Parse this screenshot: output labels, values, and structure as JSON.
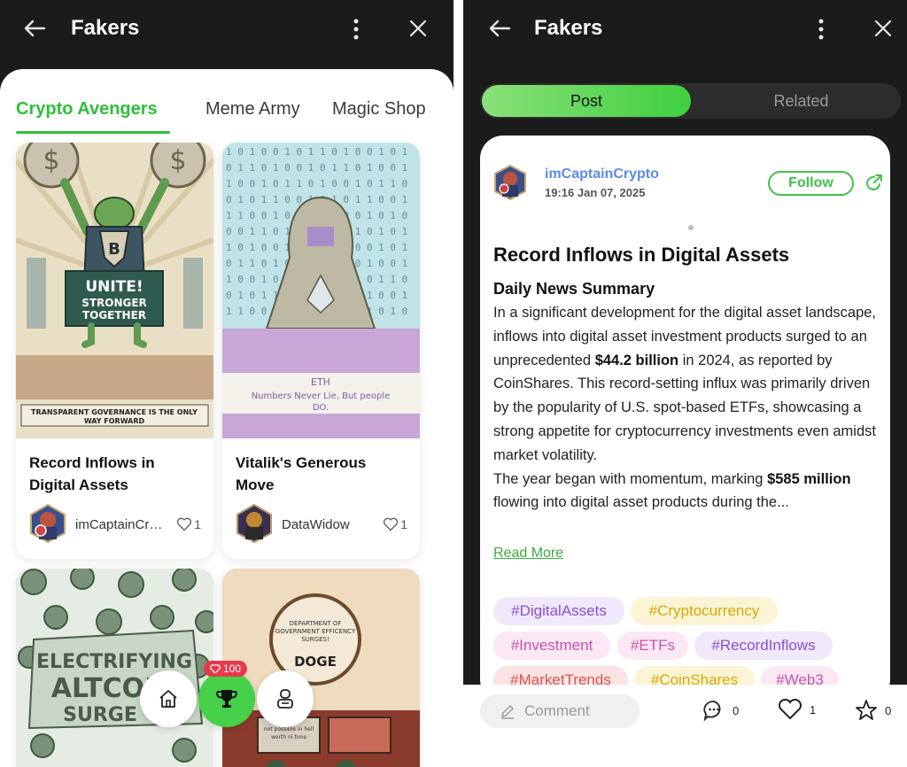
{
  "left": {
    "app_title": "Fakers",
    "tabs": [
      {
        "label": "Crypto Avengers",
        "active": true
      },
      {
        "label": "Meme Army",
        "active": false
      },
      {
        "label": "Magic Shop",
        "active": false
      }
    ],
    "cards": [
      {
        "title": "Record Inflows in Digital Assets",
        "author": "imCaptainCrypto",
        "likes": "1",
        "banner_main": "UNITE! STRONGER TOGETHER",
        "banner_caption": "TRANSPARENT GOVERNANCE IS THE ONLY WAY FORWARD"
      },
      {
        "title": "Vitalik's Generous Move",
        "author": "DataWidow",
        "likes": "1",
        "caption_title": "ETH",
        "caption_text": "Numbers Never Lie, But people DO."
      },
      {
        "image_text": "ELECTRIFYING ALTCOIN SURGE"
      },
      {
        "sign_top": "DEPARTMENT OF GOVERNMENT EFFICENCY SURGES!",
        "sign_main": "DOGE",
        "screen_text": "not possible in hell worth ni time"
      }
    ],
    "bottom_nav": {
      "gem_count": "100",
      "items": [
        "home-icon",
        "trophy-icon",
        "profile-icon"
      ]
    }
  },
  "right": {
    "app_title": "Fakers",
    "segments": {
      "active": "Post",
      "inactive": "Related"
    },
    "post": {
      "username": "imCaptainCrypto",
      "timestamp": "19:16 Jan 07, 2025",
      "follow_label": "Follow",
      "title": "Record Inflows in Digital Assets",
      "subtitle": "Daily News Summary",
      "body_1a": "In a significant development for the digital asset landscape, inflows into digital asset investment products surged to an unprecedented ",
      "body_1b": "$44.2 billion",
      "body_1c": " in 2024, as reported by CoinShares. This record-setting influx was primarily driven by the popularity of U.S. spot-based ETFs, showcasing a strong appetite for cryptocurrency investments even amidst market volatility.",
      "body_2a": "The year began with momentum, marking ",
      "body_2b": "$585 million",
      "body_2c": " flowing into digital asset products during the...",
      "read_more": "Read More",
      "tags": [
        "#DigitalAssets",
        "#Cryptocurrency",
        "#Investment",
        "#ETFs",
        "#RecordInflows",
        "#MarketTrends",
        "#CoinShares",
        "#Web3"
      ]
    },
    "bottom_bar": {
      "comment_placeholder": "Comment",
      "comments": "0",
      "likes": "1",
      "stars": "0"
    }
  }
}
